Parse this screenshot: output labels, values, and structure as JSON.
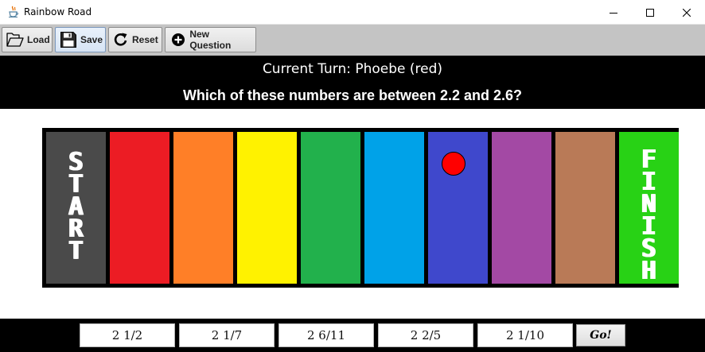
{
  "window": {
    "title": "Rainbow Road",
    "app_icon": "java-cup-icon",
    "controls": [
      "minimize-icon",
      "maximize-icon",
      "close-icon"
    ]
  },
  "toolbar": {
    "buttons": [
      {
        "label": "Load",
        "icon": "folder-icon"
      },
      {
        "label": "Save",
        "icon": "floppy-disk-icon"
      },
      {
        "label": "Reset",
        "icon": "refresh-icon"
      },
      {
        "label": "New Question",
        "icon": "plus-circle-icon"
      }
    ]
  },
  "header": {
    "current_turn": "Current Turn: Phoebe (red)",
    "question": "Which of these numbers are between 2.2 and 2.6?"
  },
  "board": {
    "start_label": "START",
    "finish_label": "FINISH",
    "lane_colors": [
      "#4a4a4a",
      "#ec1c24",
      "#ff7f27",
      "#fff200",
      "#22b14c",
      "#00a2e8",
      "#3f48cc",
      "#a349a4",
      "#b97a57",
      "#28d215"
    ],
    "token": {
      "player": "Phoebe",
      "color": "#ff0000",
      "lane_index": 6
    }
  },
  "answers": {
    "options": [
      "2 1/2",
      "2 1/7",
      "2 6/11",
      "2 2/5",
      "2 1/10"
    ],
    "go_label": "Go!"
  }
}
